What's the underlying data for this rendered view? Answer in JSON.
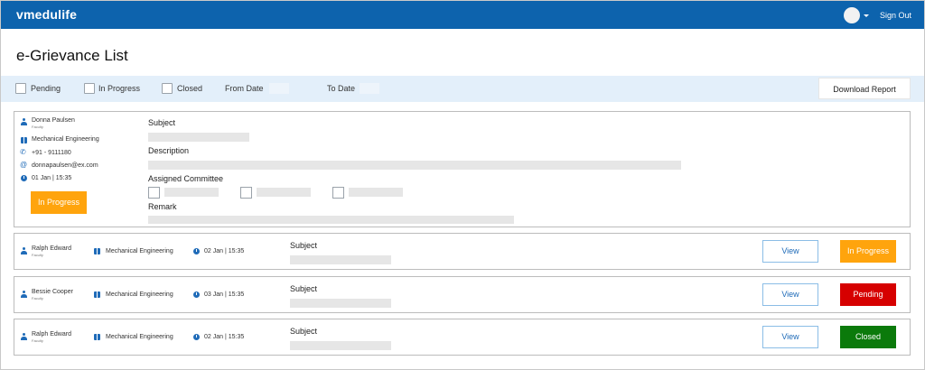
{
  "header": {
    "brand": "vmedulife",
    "sign_out": "Sign Out"
  },
  "page": {
    "title": "e-Grievance List"
  },
  "filters": {
    "pending": "Pending",
    "in_progress": "In Progress",
    "closed": "Closed",
    "from_date": "From Date",
    "to_date": "To Date",
    "download": "Download Report"
  },
  "expanded": {
    "name": "Donna Paulsen",
    "role": "Faculty",
    "department": "Mechanical Engineering",
    "phone": "+91 - 9111180",
    "email": "donnapaulsen@ex.com",
    "datetime": "01 Jan | 15:35",
    "status": "In Progress",
    "subject_label": "Subject",
    "description_label": "Description",
    "committee_label": "Assigned Committee",
    "remark_label": "Remark"
  },
  "rows": [
    {
      "name": "Ralph Edward",
      "role": "Faculty",
      "department": "Mechanical Engineering",
      "datetime": "02 Jan | 15:35",
      "subject_label": "Subject",
      "view": "View",
      "status": "In Progress"
    },
    {
      "name": "Bessie Cooper",
      "role": "Faculty",
      "department": "Mechanical Engineering",
      "datetime": "03 Jan | 15:35",
      "subject_label": "Subject",
      "view": "View",
      "status": "Pending"
    },
    {
      "name": "Ralph Edward",
      "role": "Faculty",
      "department": "Mechanical Engineering",
      "datetime": "02 Jan | 15:35",
      "subject_label": "Subject",
      "view": "View",
      "status": "Closed"
    }
  ],
  "colors": {
    "header_bg": "#0d63ad",
    "filter_bg": "#e3effa",
    "in_progress": "#ffa40d",
    "pending": "#d60000",
    "closed": "#0b7a0b",
    "icon": "#1f6bb8"
  }
}
